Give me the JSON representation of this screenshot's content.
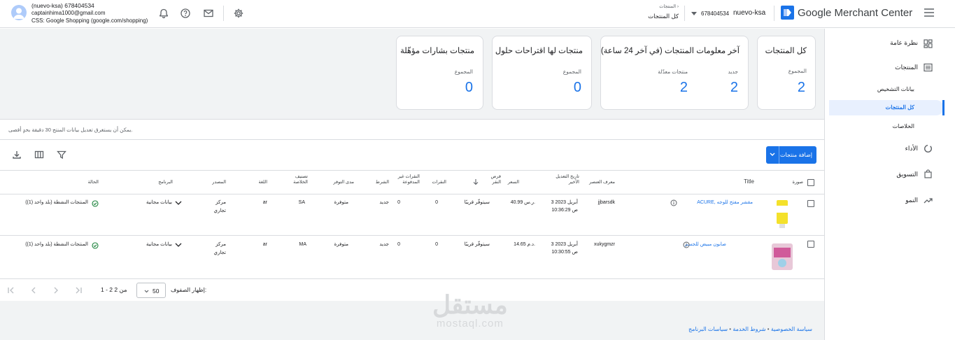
{
  "header": {
    "account_line1": "(nuevo-ksa) 678404534",
    "account_email": "captainhima1000@gmail.com",
    "account_css": "CSS: Google Shopping (google.com/shopping)",
    "breadcrumb_parent": "المنتجات",
    "breadcrumb_current": "كل المنتجات",
    "account_id": "678404534",
    "account_name": "nuevo-ksa",
    "brand": "Google Merchant Center"
  },
  "sidebar": {
    "items": [
      {
        "label": "نظرة عامة",
        "icon": "dashboard-icon"
      },
      {
        "label": "المنتجات",
        "icon": "list-icon"
      },
      {
        "label": "الأداء",
        "icon": "performance-icon"
      },
      {
        "label": "التسويق",
        "icon": "shopping-bag-icon"
      },
      {
        "label": "النمو",
        "icon": "trending-up-icon"
      }
    ],
    "sub_items": [
      "بيانات التشخيص",
      "كل المنتجات",
      "الخلاصات"
    ],
    "active_sub": "كل المنتجات"
  },
  "cards": {
    "all_products": {
      "title": "كل المنتجات",
      "total_label": "المجموع",
      "total": "2"
    },
    "latest_info": {
      "title": "آخر معلومات المنتجات (في آخر 24 ساعة)",
      "new_label": "جديد",
      "new": "2",
      "updated_label": "منتجات معدّلة",
      "updated": "2"
    },
    "suggestions": {
      "title": "منتجات لها اقتراحات حلول",
      "total_label": "المجموع",
      "total": "0"
    },
    "badges": {
      "title": "منتجات بشارات مؤهّلة",
      "total_label": "المجموع",
      "total": "0"
    }
  },
  "note": "يمكن أن يستغرق تعديل بيانات المنتج 30 دقيقة بحدٍ أقصى.",
  "toolbar": {
    "add_label": "إضافة منتجات"
  },
  "table": {
    "headers": {
      "image": "صورة",
      "title": "Title",
      "item_id": "معرف العنصر",
      "last_update": "تاريخ التعديل الأخير",
      "price": "السعر",
      "clicks_opportunity": "فرص النقر",
      "clicks": "النقرات",
      "unpaid_clicks": "النقرات غير المدفوعة",
      "condition": "الشرط",
      "availability": "مدى التوفر",
      "feed_label": "تصنيف الخلاصة",
      "language": "اللغة",
      "source": "المصدر",
      "program": "البرنامج",
      "status": "الحالة"
    },
    "rows": [
      {
        "title": "ACURE, مقشر مفتح للوجه",
        "item_id": "jjbarsdk",
        "date": "3 أبريل 2023",
        "time": "10:36:29 ص",
        "price": "40.99 ر.س.",
        "opportunity": "سيتوفّر قريبًا",
        "clicks": "0",
        "unpaid": "0",
        "condition": "جديد",
        "availability": "متوفرة",
        "feed": "SA",
        "lang": "ar",
        "source_1": "مركز",
        "source_2": "تجاري",
        "program": "بيانات مجانية",
        "status": "المنتجات النشطة (بلد واحد (1))"
      },
      {
        "title": "صابون مبيض للجسم",
        "item_id": "xukygmzr",
        "date": "3 أبريل 2023",
        "time": "10:30:55 ص",
        "price": "14.65 د.م.",
        "opportunity": "سيتوفّر قريبًا",
        "clicks": "0",
        "unpaid": "0",
        "condition": "جديد",
        "availability": "متوفرة",
        "feed": "MA",
        "lang": "ar",
        "source_1": "مركز",
        "source_2": "تجاري",
        "program": "بيانات مجانية",
        "status": "المنتجات النشطة (بلد واحد (1))"
      }
    ]
  },
  "pager": {
    "rows_label": "إظهار الصفوف:",
    "rows_value": "50",
    "range": "1 - 2 من 2"
  },
  "footer": {
    "privacy": "سياسة الخصوصية",
    "terms": "شروط الخدمة",
    "policies": "سياسات البرنامج",
    "sep": "•"
  },
  "watermark": {
    "arabic": "مستقل",
    "latin": "mostaql.com"
  },
  "colors": {
    "accent": "#1a73e8",
    "status_ok": "#188038"
  }
}
